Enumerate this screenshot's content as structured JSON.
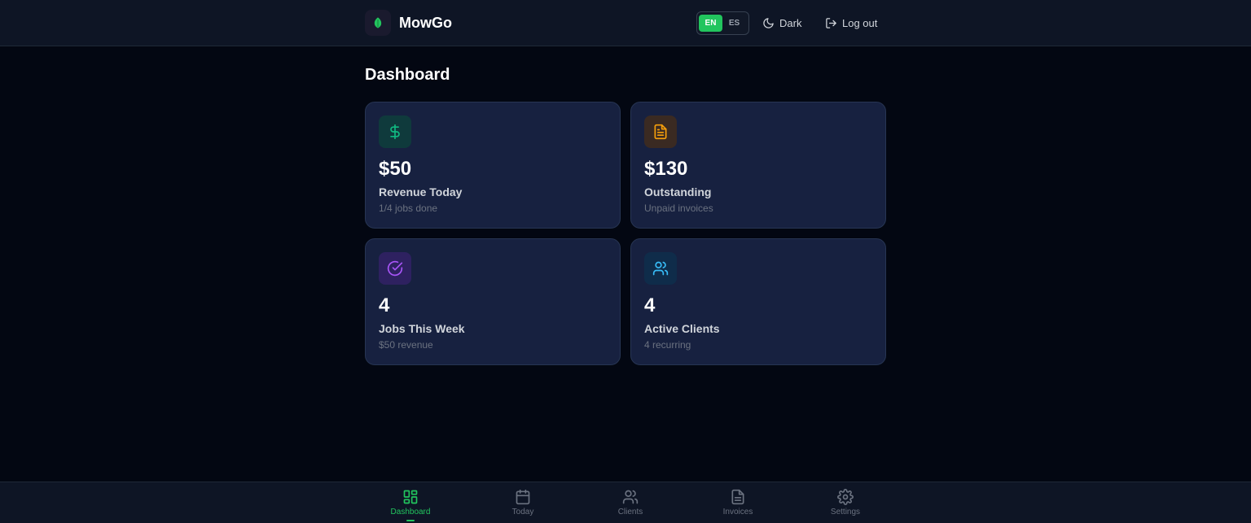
{
  "app": {
    "brand": "MowGo",
    "icon": "leaf-icon"
  },
  "header": {
    "lang_en": "EN",
    "lang_es": "ES",
    "active_lang": "EN",
    "theme_label": "Dark",
    "logout_label": "Log out"
  },
  "main": {
    "title": "Dashboard",
    "cards": [
      {
        "icon": "dollar-icon",
        "value": "$50",
        "label": "Revenue Today",
        "sub": "1/4 jobs done",
        "accent": "#10b981"
      },
      {
        "icon": "document-icon",
        "value": "$130",
        "label": "Outstanding",
        "sub": "Unpaid invoices",
        "accent": "#f59e0b"
      },
      {
        "icon": "check-circle-icon",
        "value": "4",
        "label": "Jobs This Week",
        "sub": "$50 revenue",
        "accent": "#a855f7"
      },
      {
        "icon": "users-icon",
        "value": "4",
        "label": "Active Clients",
        "sub": "4 recurring",
        "accent": "#38bdf8"
      }
    ]
  },
  "nav": {
    "items": [
      {
        "label": "Dashboard",
        "icon": "grid-icon",
        "active": true
      },
      {
        "label": "Today",
        "icon": "calendar-icon",
        "active": false
      },
      {
        "label": "Clients",
        "icon": "users-icon",
        "active": false
      },
      {
        "label": "Invoices",
        "icon": "invoice-icon",
        "active": false
      },
      {
        "label": "Settings",
        "icon": "gear-icon",
        "active": false
      }
    ]
  },
  "colors": {
    "accent": "#22c55e",
    "background": "#030712",
    "card": "#172140"
  }
}
